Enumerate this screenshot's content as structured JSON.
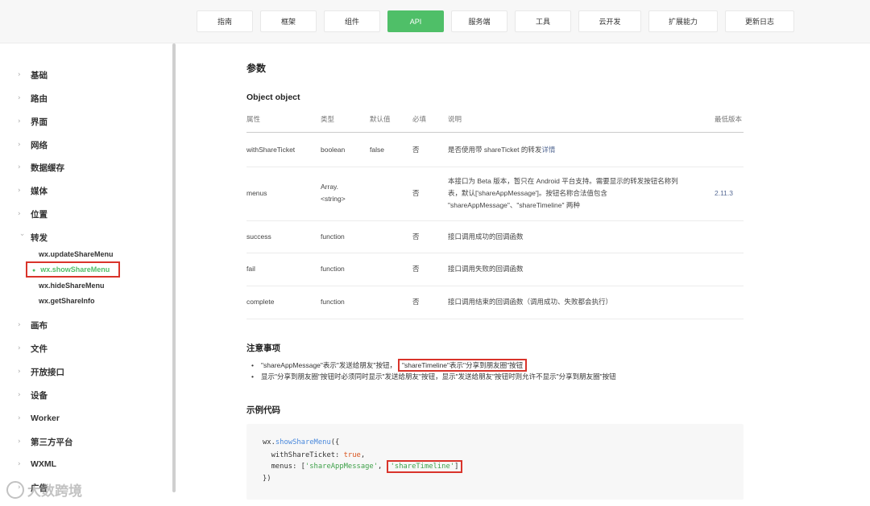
{
  "nav": {
    "items": [
      {
        "label": "指南"
      },
      {
        "label": "框架"
      },
      {
        "label": "组件"
      },
      {
        "label": "API"
      },
      {
        "label": "服务端"
      },
      {
        "label": "工具"
      },
      {
        "label": "云开发"
      },
      {
        "label": "扩展能力"
      },
      {
        "label": "更新日志"
      }
    ],
    "active_index": 3
  },
  "sidebar": {
    "items": [
      {
        "label": "基础"
      },
      {
        "label": "路由"
      },
      {
        "label": "界面"
      },
      {
        "label": "网络"
      },
      {
        "label": "数据缓存"
      },
      {
        "label": "媒体"
      },
      {
        "label": "位置"
      },
      {
        "label": "转发"
      },
      {
        "label": "画布"
      },
      {
        "label": "文件"
      },
      {
        "label": "开放接口"
      },
      {
        "label": "设备"
      },
      {
        "label": "Worker"
      },
      {
        "label": "第三方平台"
      },
      {
        "label": "WXML"
      },
      {
        "label": "广告"
      }
    ],
    "sub_items": [
      {
        "label": "wx.updateShareMenu"
      },
      {
        "label": "wx.showShareMenu"
      },
      {
        "label": "wx.hideShareMenu"
      },
      {
        "label": "wx.getShareInfo"
      }
    ]
  },
  "main": {
    "params_title": "参数",
    "object_title": "Object object",
    "table": {
      "headers": [
        "属性",
        "类型",
        "默认值",
        "必填",
        "说明",
        "最低版本"
      ],
      "rows": [
        {
          "name": "withShareTicket",
          "type": "boolean",
          "default": "false",
          "required": "否",
          "desc": "是否使用带 shareTicket 的转发",
          "desc_link": "详情",
          "version": ""
        },
        {
          "name": "menus",
          "type_line1": "Array.",
          "type_line2": "<string>",
          "default": "",
          "required": "否",
          "desc_line1": "本接口为 Beta 版本，暂只在 Android 平台支持。需要显示的转发按钮名称列",
          "desc_line2": "表，默认['shareAppMessage']。按钮名称合法值包含",
          "desc_line3": "\"shareAppMessage\"、\"shareTimeline\" 两种",
          "version": "2.11.3"
        },
        {
          "name": "success",
          "type": "function",
          "default": "",
          "required": "否",
          "desc": "接口调用成功的回调函数",
          "version": ""
        },
        {
          "name": "fail",
          "type": "function",
          "default": "",
          "required": "否",
          "desc": "接口调用失败的回调函数",
          "version": ""
        },
        {
          "name": "complete",
          "type": "function",
          "default": "",
          "required": "否",
          "desc": "接口调用结束的回调函数（调用成功、失败都会执行）",
          "version": ""
        }
      ]
    },
    "notes_title": "注意事项",
    "notes": [
      {
        "text": "\"shareAppMessage\"表示\"发送给朋友\"按钮，",
        "highlight": "\"shareTimeline\"表示\"分享到朋友圈\"按钮"
      },
      {
        "text": "显示\"分享到朋友圈\"按钮时必须同时显示\"发送给朋友\"按钮，显示\"发送给朋友\"按钮时则允许不显示\"分享到朋友圈\"按钮"
      }
    ],
    "example_title": "示例代码",
    "code": {
      "l1_obj": "wx.",
      "l1_fn": "showShareMenu",
      "l1_rest": "({",
      "l2_key": "  withShareTicket: ",
      "l2_val": "true",
      "l2_end": ",",
      "l3_key": "  menus: [",
      "l3_s1": "'shareAppMessage'",
      "l3_sep": ", ",
      "l3_s2": "'shareTimeline'",
      "l3_end": "]",
      "l4": "})"
    }
  },
  "watermark": {
    "text": "大数跨境"
  },
  "colors": {
    "accent": "#4fbf68",
    "highlight_border": "#d9342b",
    "link": "#576b95"
  }
}
